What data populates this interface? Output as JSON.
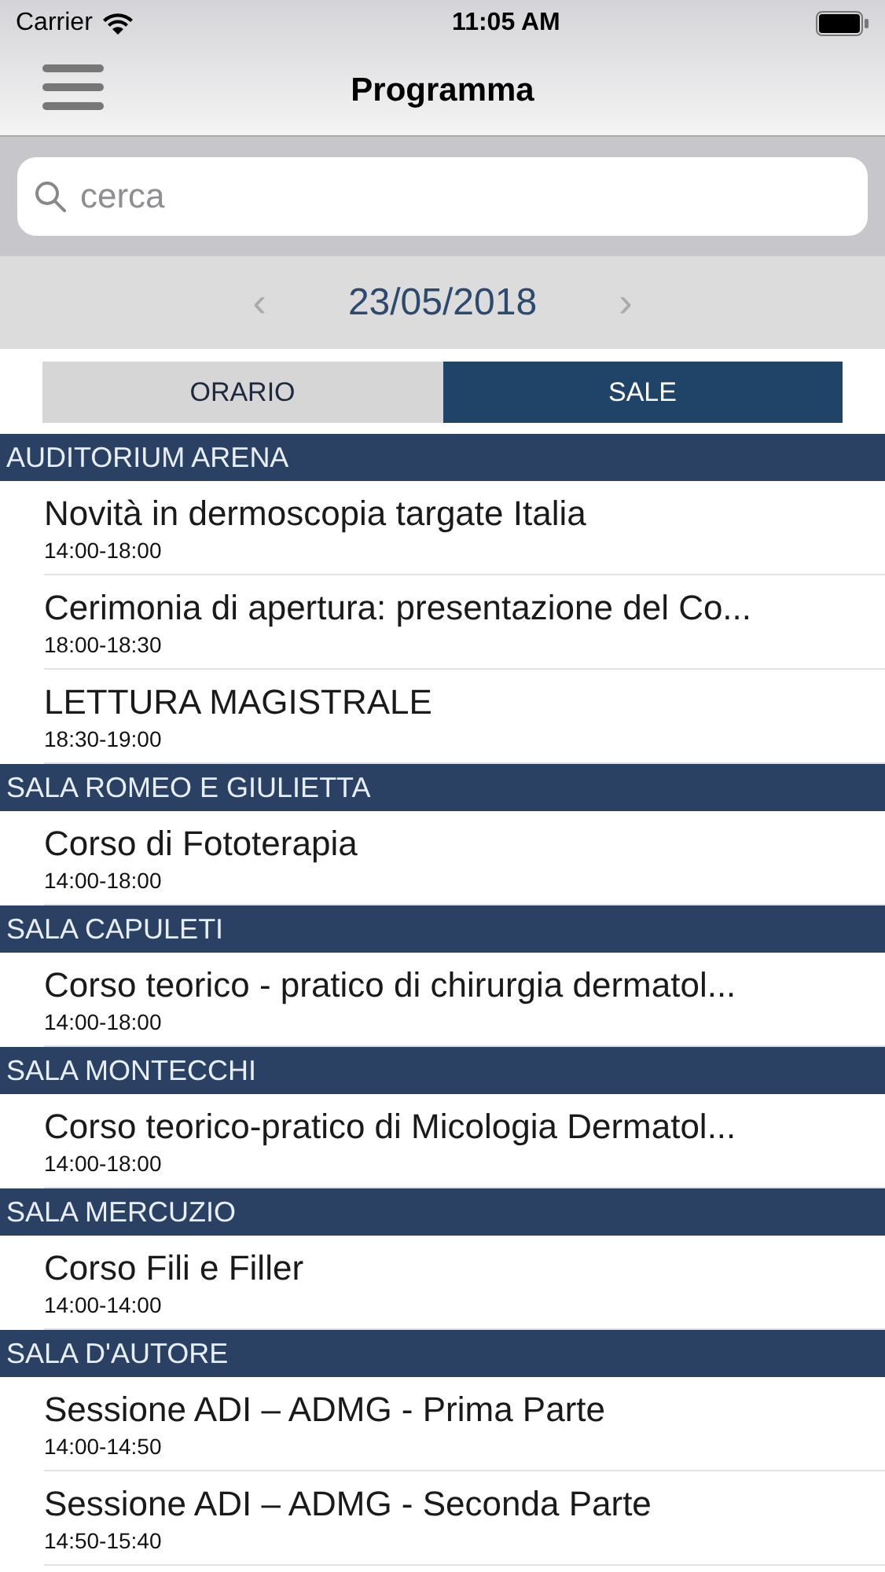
{
  "status_bar": {
    "carrier": "Carrier",
    "time": "11:05 AM"
  },
  "nav": {
    "title": "Programma"
  },
  "search": {
    "placeholder": "cerca"
  },
  "date": {
    "label": "23/05/2018",
    "prev": "‹",
    "next": "›"
  },
  "tabs": [
    {
      "label": "ORARIO",
      "selected": false
    },
    {
      "label": "SALE",
      "selected": true
    }
  ],
  "sections": [
    {
      "title": "AUDITORIUM ARENA",
      "items": [
        {
          "title": "Novità in dermoscopia targate Italia",
          "time": "14:00-18:00"
        },
        {
          "title": "Cerimonia di apertura: presentazione del Co...",
          "time": "18:00-18:30"
        },
        {
          "title": "LETTURA MAGISTRALE",
          "time": "18:30-19:00"
        }
      ]
    },
    {
      "title": "SALA ROMEO E GIULIETTA",
      "items": [
        {
          "title": "Corso di Fototerapia",
          "time": "14:00-18:00"
        }
      ]
    },
    {
      "title": "SALA CAPULETI",
      "items": [
        {
          "title": "Corso teorico - pratico di chirurgia dermatol...",
          "time": "14:00-18:00"
        }
      ]
    },
    {
      "title": "SALA MONTECCHI",
      "items": [
        {
          "title": "Corso teorico-pratico di Micologia Dermatol...",
          "time": "14:00-18:00"
        }
      ]
    },
    {
      "title": "SALA MERCUZIO",
      "items": [
        {
          "title": "Corso Fili e Filler",
          "time": "14:00-14:00"
        }
      ]
    },
    {
      "title": "SALA D'AUTORE",
      "items": [
        {
          "title": "Sessione ADI – ADMG - Prima Parte",
          "time": "14:00-14:50"
        },
        {
          "title": "Sessione ADI – ADMG - Seconda Parte",
          "time": "14:50-15:40"
        }
      ]
    }
  ]
}
